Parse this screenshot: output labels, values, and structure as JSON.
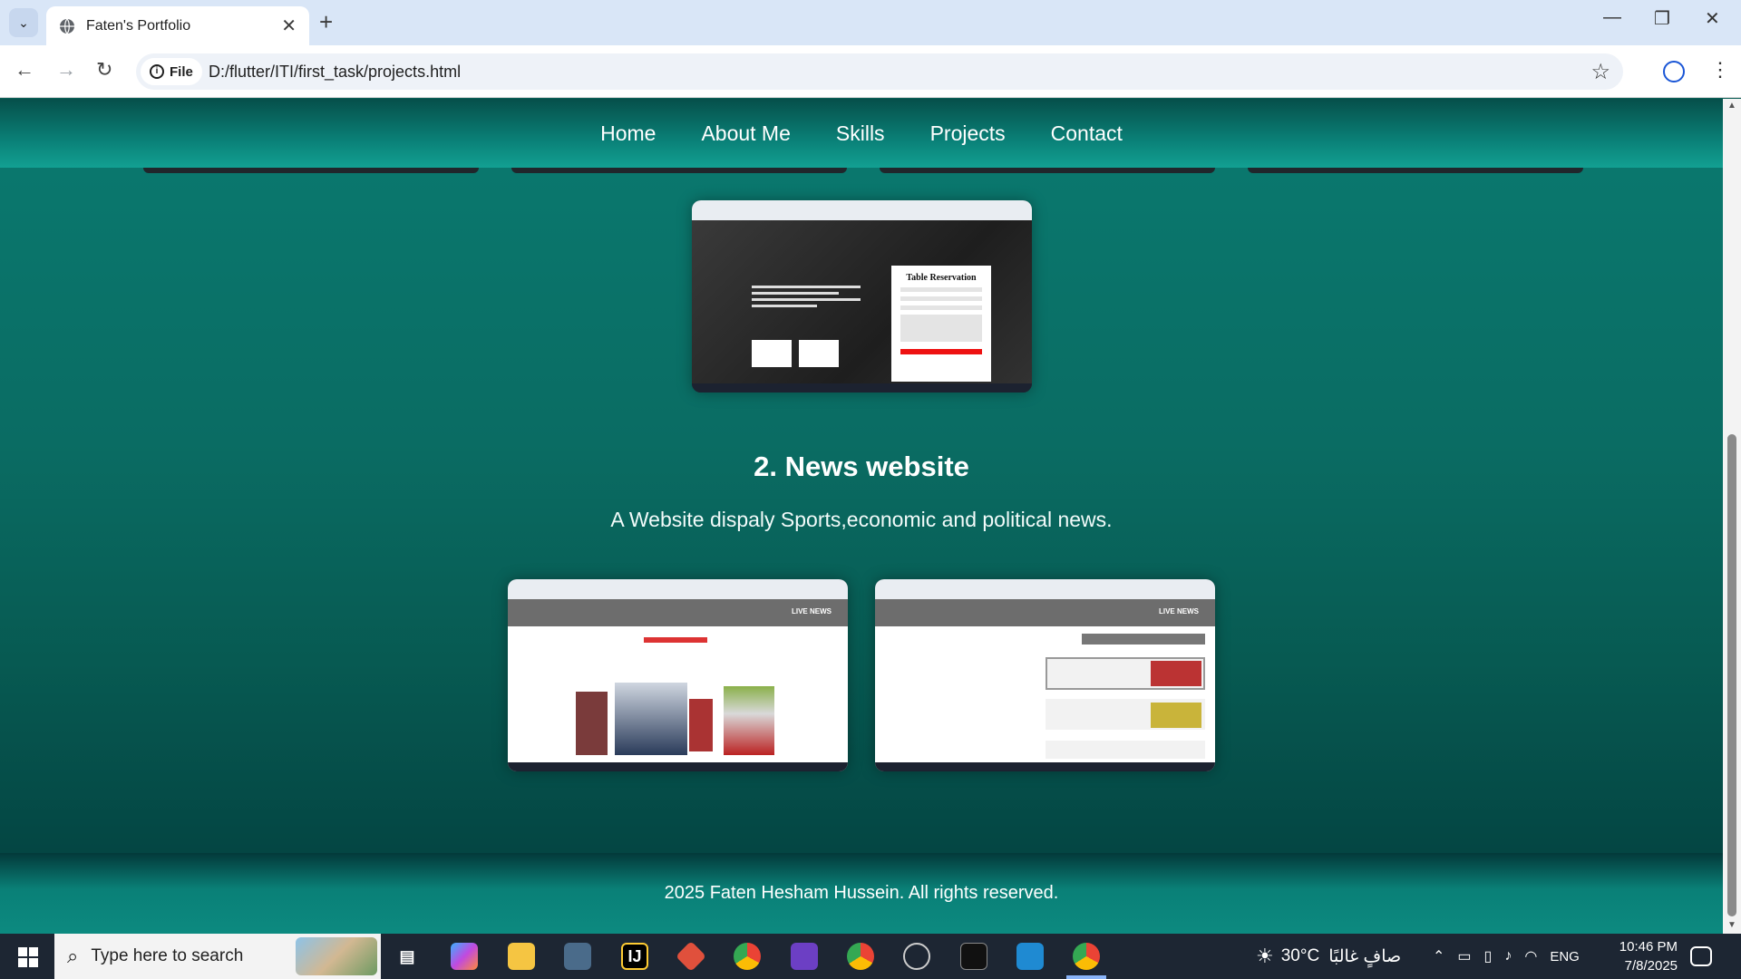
{
  "browser": {
    "tab_title": "Faten's Portfolio",
    "omnibox_chip": "File",
    "url": "D:/flutter/ITI/first_task/projects.html"
  },
  "site": {
    "nav": [
      "Home",
      "About Me",
      "Skills",
      "Projects",
      "Contact"
    ],
    "cafe_form_title": "Table Reservation",
    "news_live_label": "LIVE NEWS",
    "project2_title": "2. News website",
    "project2_desc": "A Website dispaly Sports,economic and political news.",
    "footer": "2025 Faten Hesham Hussein. All rights reserved."
  },
  "taskbar": {
    "search_placeholder": "Type here to search",
    "weather_temp": "30°C",
    "weather_text": "صافٍ غالبًا",
    "language": "ENG",
    "time": "10:46 PM",
    "date": "7/8/2025"
  },
  "colors": {
    "site_teal": "#0a7a70",
    "footer_teal": "#0c8a80",
    "chrome_tabbar": "#d9e6f7",
    "taskbar": "#1d2633"
  }
}
